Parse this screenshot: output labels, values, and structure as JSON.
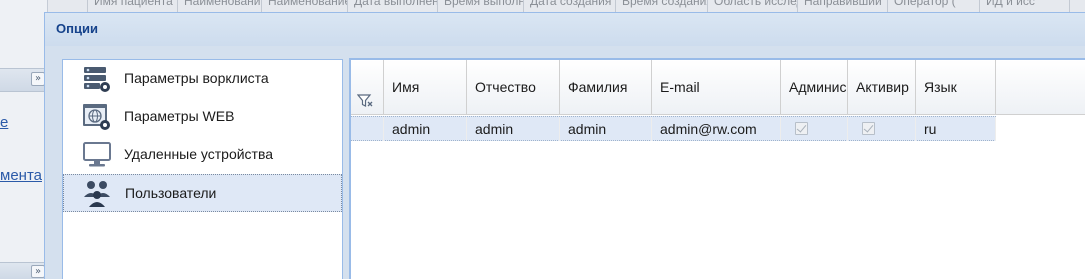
{
  "background": {
    "links": [
      "е",
      "мента"
    ],
    "column_headers": [
      "",
      "Имя пациента",
      "Наименование",
      "Наименование",
      "Дата выполнения",
      "Время выполнения",
      "Дата создания",
      "Время создания",
      "Область исследования",
      "Направивший",
      "Оператор (",
      "ИД и исс"
    ]
  },
  "dialog": {
    "title": "Опции"
  },
  "nav": {
    "items": [
      {
        "label": "Параметры ворклиста",
        "icon": "worklist-settings-icon"
      },
      {
        "label": "Параметры WEB",
        "icon": "web-settings-icon"
      },
      {
        "label": "Удаленные устройства",
        "icon": "monitor-icon"
      },
      {
        "label": "Пользователи",
        "icon": "users-icon",
        "selected": true
      }
    ]
  },
  "grid": {
    "columns": [
      "Имя",
      "Отчество",
      "Фамилия",
      "E-mail",
      "Админис",
      "Активир",
      "Язык"
    ],
    "rows": [
      {
        "first_name": "admin",
        "middle_name": "admin",
        "last_name": "admin",
        "email": "admin@rw.com",
        "is_admin": true,
        "is_active": true,
        "language": "ru"
      }
    ]
  },
  "colors": {
    "accent": "#15428b",
    "selection": "#dfe8f6",
    "panel_border": "#99bbe8"
  }
}
